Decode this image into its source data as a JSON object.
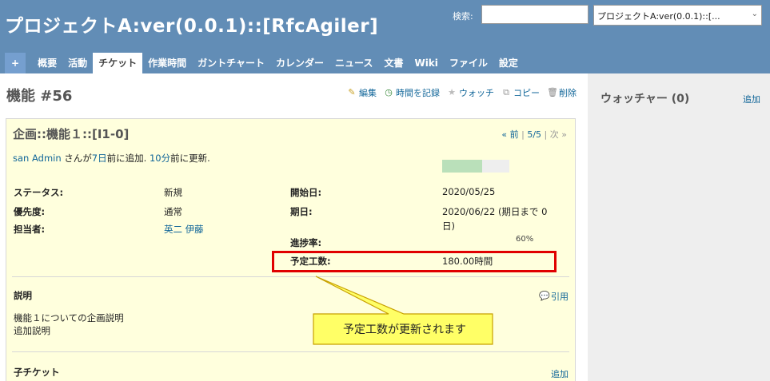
{
  "header": {
    "project_title": "プロジェクトA:ver(0.0.1)::[RfcAgiler]",
    "search_label": "検索:",
    "search_value": "",
    "project_select": "プロジェクトA:ver(0.0.1)::[..."
  },
  "tabs": [
    {
      "label": "+",
      "icon": "plus-icon"
    },
    {
      "label": "概要"
    },
    {
      "label": "活動"
    },
    {
      "label": "チケット",
      "selected": true
    },
    {
      "label": "作業時間"
    },
    {
      "label": "ガントチャート"
    },
    {
      "label": "カレンダー"
    },
    {
      "label": "ニュース"
    },
    {
      "label": "文書"
    },
    {
      "label": "Wiki"
    },
    {
      "label": "ファイル"
    },
    {
      "label": "設定"
    }
  ],
  "issue": {
    "title": "機能 #56",
    "actions": {
      "edit": "編集",
      "log_time": "時間を記録",
      "watch": "ウォッチ",
      "copy": "コピー",
      "delete": "削除"
    },
    "subject": "企画::機能１::[I1-0]",
    "nav": {
      "prev": "« 前",
      "sep1": "|",
      "position": "5/5",
      "sep2": "|",
      "next": "次 »"
    },
    "author_line": {
      "user": "san Admin",
      "text1": " さんが",
      "added": "7日",
      "text2": "前に追加. ",
      "updated": "10分",
      "text3": "前に更新."
    },
    "attributes": {
      "status_label": "ステータス:",
      "status_value": "新規",
      "priority_label": "優先度:",
      "priority_value": "通常",
      "assignee_label": "担当者:",
      "assignee_value": "英二 伊藤",
      "start_label": "開始日:",
      "start_value": "2020/05/25",
      "due_label": "期日:",
      "due_value_line1": "2020/06/22 (期日まで 0",
      "due_value_line2": "日)",
      "progress_label": "進捗率:",
      "progress_percent": 60,
      "progress_text": "60%",
      "estimated_label": "予定工数:",
      "estimated_value": "180.00時間"
    },
    "description": {
      "title": "説明",
      "quote": "引用",
      "line1": "機能１についての企画説明",
      "line2": "追加説明"
    },
    "subtasks": {
      "title": "子チケット",
      "add": "追加"
    }
  },
  "sidebar": {
    "watchers_title": "ウォッチャー (0)",
    "add": "追加"
  },
  "callout": {
    "text": "予定工数が更新されます"
  },
  "colors": {
    "header_bg": "#628db6",
    "highlight_border": "#e00000",
    "callout_fill": "#ffff66",
    "issue_bg": "#ffffdd"
  }
}
